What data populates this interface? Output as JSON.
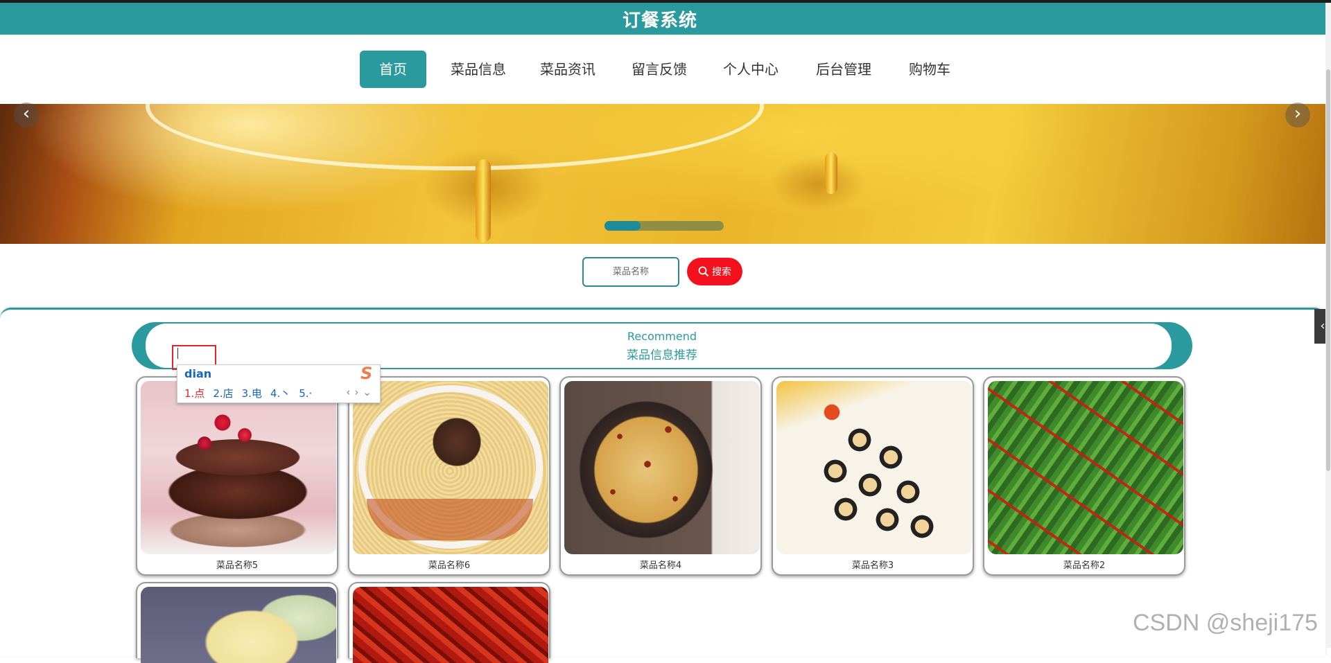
{
  "app": {
    "title": "订餐系统"
  },
  "nav": {
    "items": [
      {
        "label": "首页",
        "active": true
      },
      {
        "label": "菜品信息",
        "active": false
      },
      {
        "label": "菜品资讯",
        "active": false
      },
      {
        "label": "留言反馈",
        "active": false
      },
      {
        "label": "个人中心",
        "active": false
      },
      {
        "label": "后台管理",
        "active": false
      },
      {
        "label": "购物车",
        "active": false
      }
    ]
  },
  "carousel": {
    "prev_icon": "chevron-left-icon",
    "next_icon": "chevron-right-icon",
    "slide_count": 3,
    "active_slide": 1
  },
  "search": {
    "placeholder": "菜品名称",
    "button_label": "搜索",
    "button_icon": "search-icon"
  },
  "recommend": {
    "title_en": "Recommend",
    "title_cn": "菜品信息推荐",
    "items": [
      {
        "name": "菜品名称5"
      },
      {
        "name": "菜品名称6"
      },
      {
        "name": "菜品名称4"
      },
      {
        "name": "菜品名称3"
      },
      {
        "name": "菜品名称2"
      },
      {
        "name": ""
      },
      {
        "name": ""
      }
    ]
  },
  "ime": {
    "pinyin": "dian",
    "candidates": [
      "1.点",
      "2.店",
      "3.电",
      "4.丶",
      "5.·"
    ]
  },
  "watermark": "CSDN @sheji175",
  "colors": {
    "primary": "#2a9a9f",
    "search_button": "#f4111e",
    "ime_text": "#1466c0",
    "ime_first": "#e0262a"
  }
}
